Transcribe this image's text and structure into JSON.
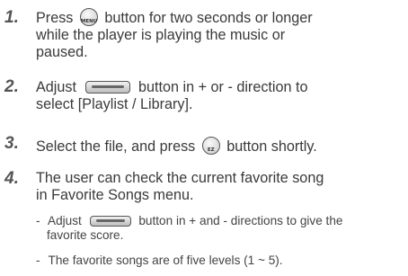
{
  "steps": [
    {
      "number": "1.",
      "pre": "Press",
      "icon": "MENU",
      "post": "button for two seconds or longer",
      "line2": "while the player is playing the music or",
      "line3": "paused."
    },
    {
      "number": "2.",
      "pre": "Adjust",
      "post": "button in + or - direction to",
      "line2": "select [Playlist / Library]."
    },
    {
      "number": "3.",
      "pre": "Select the file, and press",
      "icon": "EZ",
      "post": "button shortly."
    },
    {
      "number": "4.",
      "line1": "The user can check the current favorite song",
      "line2": "in Favorite Songs menu."
    }
  ],
  "notes": [
    {
      "dash": "-",
      "pre": "Adjust",
      "post": "button in + and - directions to give the",
      "line2": "favorite score."
    },
    {
      "dash": "-",
      "text": "The favorite songs are of five levels (1 ~ 5)."
    }
  ]
}
